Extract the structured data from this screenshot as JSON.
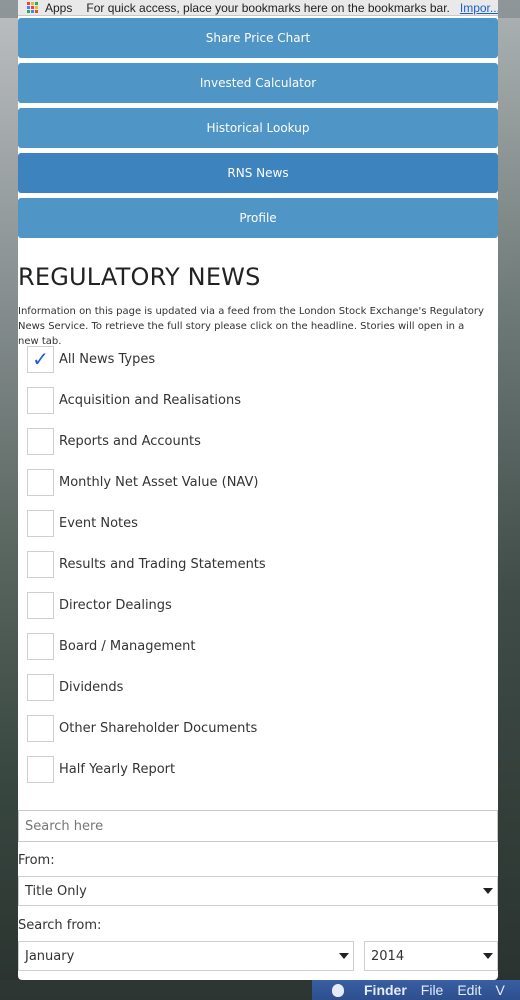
{
  "bookmarks_bar": {
    "apps_label": "Apps",
    "hint": "For quick access, place your bookmarks here on the bookmarks bar.",
    "import_link": "Impor..."
  },
  "nav": [
    {
      "label": "Share Price Chart",
      "active": false
    },
    {
      "label": "Invested Calculator",
      "active": false
    },
    {
      "label": "Historical Lookup",
      "active": false
    },
    {
      "label": "RNS News",
      "active": true
    },
    {
      "label": "Profile",
      "active": false
    }
  ],
  "section": {
    "title": "REGULATORY NEWS",
    "intro": "Information on this page is updated via a feed from the London Stock Exchange's Regulatory News Service. To retrieve the full story please click on the headline. Stories will open in a new tab."
  },
  "filters": [
    {
      "label": "All News Types",
      "checked": true
    },
    {
      "label": "Acquisition and Realisations",
      "checked": false
    },
    {
      "label": "Reports and Accounts",
      "checked": false
    },
    {
      "label": "Monthly Net Asset Value (NAV)",
      "checked": false
    },
    {
      "label": "Event Notes",
      "checked": false
    },
    {
      "label": "Results and Trading Statements",
      "checked": false
    },
    {
      "label": "Director Dealings",
      "checked": false
    },
    {
      "label": "Board / Management",
      "checked": false
    },
    {
      "label": "Dividends",
      "checked": false
    },
    {
      "label": "Other Shareholder Documents",
      "checked": false
    },
    {
      "label": "Half Yearly Report",
      "checked": false
    }
  ],
  "search": {
    "placeholder": "Search here",
    "from_label": "From:",
    "from_value": "Title Only",
    "search_from_label": "Search from:",
    "month_value": "January",
    "year_value": "2014"
  },
  "menubar": {
    "finder": "Finder",
    "file": "File",
    "edit": "Edit",
    "cut": "V"
  },
  "colors": {
    "nav_button": "#4f95c6",
    "nav_active": "#3d83be",
    "check_accent": "#1c5fd0"
  }
}
